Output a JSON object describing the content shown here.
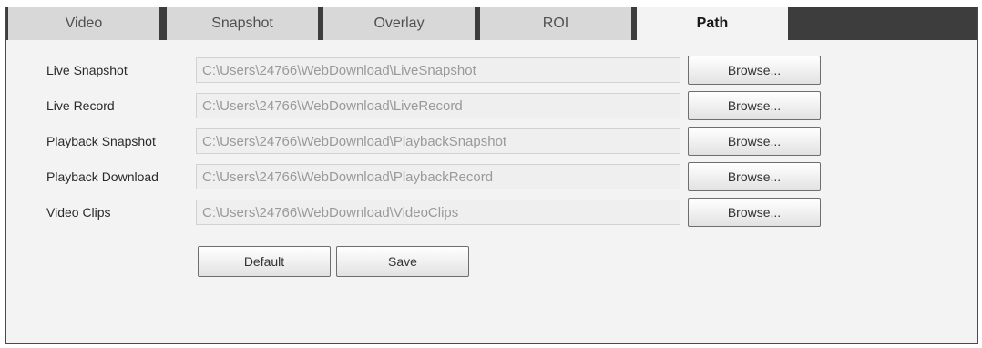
{
  "tabs": [
    {
      "label": "Video",
      "active": false
    },
    {
      "label": "Snapshot",
      "active": false
    },
    {
      "label": "Overlay",
      "active": false
    },
    {
      "label": "ROI",
      "active": false
    },
    {
      "label": "Path",
      "active": true
    }
  ],
  "rows": [
    {
      "label": "Live Snapshot",
      "value": "C:\\Users\\24766\\WebDownload\\LiveSnapshot",
      "browse_label": "Browse..."
    },
    {
      "label": "Live Record",
      "value": "C:\\Users\\24766\\WebDownload\\LiveRecord",
      "browse_label": "Browse..."
    },
    {
      "label": "Playback Snapshot",
      "value": "C:\\Users\\24766\\WebDownload\\PlaybackSnapshot",
      "browse_label": "Browse..."
    },
    {
      "label": "Playback Download",
      "value": "C:\\Users\\24766\\WebDownload\\PlaybackRecord",
      "browse_label": "Browse..."
    },
    {
      "label": "Video Clips",
      "value": "C:\\Users\\24766\\WebDownload\\VideoClips",
      "browse_label": "Browse..."
    }
  ],
  "actions": {
    "default_label": "Default",
    "save_label": "Save"
  },
  "colors": {
    "tab_bar": "#3d3d3d",
    "tab_inactive": "#d8d8d8",
    "tab_active": "#f3f3f3",
    "panel": "#f3f3f3"
  }
}
